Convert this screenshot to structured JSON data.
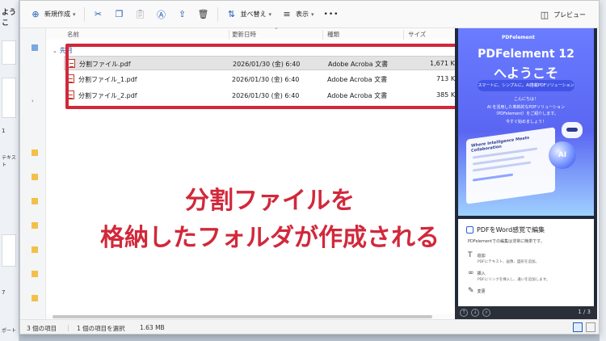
{
  "toolbar": {
    "new_label": "新規作成",
    "sort_label": "並べ替え",
    "view_label": "表示",
    "more_label": "•••",
    "preview_label": "プレビュー"
  },
  "columns": {
    "name": "名前",
    "modified": "更新日時",
    "type": "種類",
    "size": "サイズ"
  },
  "group": {
    "label": "先月"
  },
  "files": [
    {
      "name": "分割ファイル.pdf",
      "modified": "2026/01/30 (金) 6:40",
      "type": "Adobe Acroba 文書",
      "size": "1,671 KB",
      "selected": true
    },
    {
      "name": "分割ファイル_1.pdf",
      "modified": "2026/01/30 (金) 6:40",
      "type": "Adobe Acroba 文書",
      "size": "713 KB",
      "selected": false
    },
    {
      "name": "分割ファイル_2.pdf",
      "modified": "2026/01/30 (金) 6:40",
      "type": "Adobe Acroba 文書",
      "size": "385 KB",
      "selected": false
    }
  ],
  "caption": {
    "line1": "分割ファイルを",
    "line2": "格納したフォルダが作成される"
  },
  "preview": {
    "brand": "PDFelement",
    "title1": "PDFelement 12",
    "title2": "へようこそ",
    "pill": "スマートに、シンプルに。AI搭載PDFソリューション",
    "greet": "こんにちは！",
    "line1": "AI を活用した革新的なPDFソリューション",
    "line2": "（PDFelement）をご紹介します。",
    "line3": "今すぐ始めましょう！",
    "card_title": "Where Intelligence Meets Collaboration",
    "ai_badge": "AI",
    "page2_heading": "PDFをWord感覚で編集",
    "page2_sub": "PDFelementでの編集は非常に簡単です。",
    "item1_title": "追加",
    "item1_desc": "PDFにテキスト、画像、図形を追加。",
    "item2_title": "挿入",
    "item2_desc": "PDFにリンクを挿入し、違いを追加します。",
    "item3_title": "変更",
    "page_counter": "1 / 3"
  },
  "status": {
    "count": "3 個の項目",
    "selection": "1 個の項目を選択",
    "size": "1.63 MB"
  },
  "background": {
    "nums": [
      "1",
      "7"
    ],
    "txt1": "ようこ",
    "txt2": "テキスト",
    "txt3": "ポート"
  }
}
